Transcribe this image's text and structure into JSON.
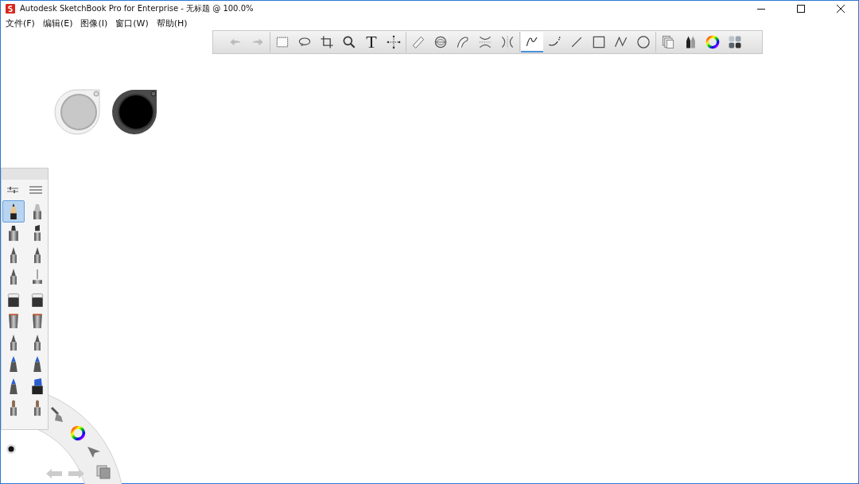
{
  "window": {
    "title": "Autodesk SketchBook Pro for Enterprise - 无标题 @ 100.0%"
  },
  "menu": [
    "文件(F)",
    "编辑(E)",
    "图像(I)",
    "窗口(W)",
    "帮助(H)"
  ],
  "toolbar": [
    {
      "kind": "undo",
      "selected": false
    },
    {
      "kind": "redo",
      "selected": false
    },
    {
      "kind": "sep"
    },
    {
      "kind": "rect-select",
      "selected": false
    },
    {
      "kind": "lasso",
      "selected": false
    },
    {
      "kind": "crop",
      "selected": false
    },
    {
      "kind": "zoom",
      "selected": false
    },
    {
      "kind": "text",
      "glyph": "T",
      "selected": false
    },
    {
      "kind": "move",
      "selected": false
    },
    {
      "kind": "sep"
    },
    {
      "kind": "ruler",
      "selected": false
    },
    {
      "kind": "ellipse",
      "selected": false
    },
    {
      "kind": "curve",
      "selected": false
    },
    {
      "kind": "sym-x",
      "selected": false
    },
    {
      "kind": "sym-y",
      "selected": false
    },
    {
      "kind": "sep"
    },
    {
      "kind": "stroke",
      "selected": true
    },
    {
      "kind": "polycurve",
      "selected": false
    },
    {
      "kind": "line",
      "selected": false
    },
    {
      "kind": "rect",
      "selected": false
    },
    {
      "kind": "polyline",
      "selected": false
    },
    {
      "kind": "circle",
      "selected": false
    },
    {
      "kind": "sep"
    },
    {
      "kind": "layers",
      "selected": false
    },
    {
      "kind": "brushes",
      "selected": false
    },
    {
      "kind": "color",
      "selected": false
    },
    {
      "kind": "swatches",
      "selected": false
    }
  ],
  "brushes": [
    {
      "kind": "pencil",
      "selected": true
    },
    {
      "kind": "airbrush",
      "selected": false
    },
    {
      "kind": "marker",
      "selected": false
    },
    {
      "kind": "chisel",
      "selected": false
    },
    {
      "kind": "pen",
      "selected": false
    },
    {
      "kind": "pen",
      "selected": false
    },
    {
      "kind": "pen",
      "selected": false
    },
    {
      "kind": "stamp",
      "selected": false
    },
    {
      "kind": "eraser",
      "selected": false
    },
    {
      "kind": "eraser",
      "selected": false
    },
    {
      "kind": "bucket",
      "selected": false
    },
    {
      "kind": "bucket",
      "selected": false
    },
    {
      "kind": "pen",
      "selected": false
    },
    {
      "kind": "pen",
      "selected": false
    },
    {
      "kind": "blue",
      "selected": false
    },
    {
      "kind": "blue",
      "selected": false
    },
    {
      "kind": "blue",
      "selected": false
    },
    {
      "kind": "ink",
      "selected": false
    },
    {
      "kind": "brush",
      "selected": false
    },
    {
      "kind": "brush",
      "selected": false
    }
  ]
}
